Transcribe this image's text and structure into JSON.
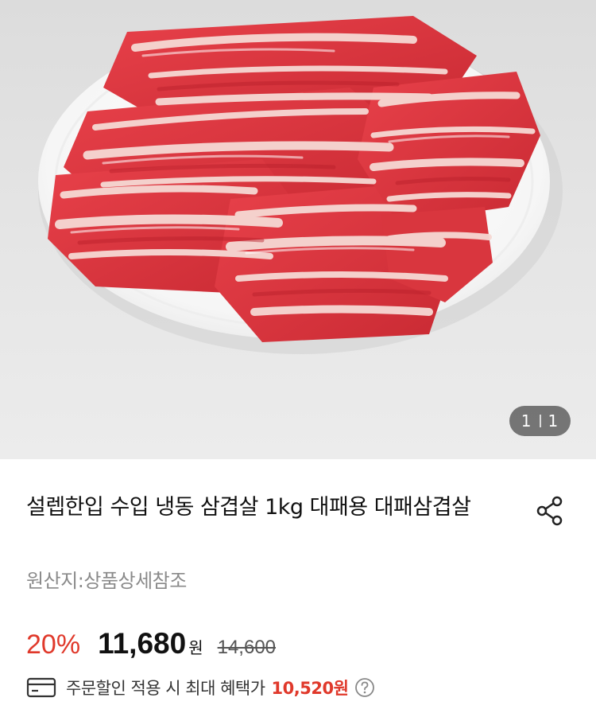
{
  "gallery": {
    "current": "1",
    "total": "1"
  },
  "product": {
    "title": "설렙한입 수입 냉동 삼겹살 1kg 대패용 대패삼겹살",
    "origin": "원산지:상품상세참조"
  },
  "pricing": {
    "discount": "20%",
    "price": "11,680",
    "price_unit": "원",
    "original_price": "14,600"
  },
  "benefit": {
    "text": "주문할인 적용 시 최대 혜택가",
    "amount": "10,520원"
  },
  "icons": {
    "share": "share-icon",
    "card": "card-icon",
    "help": "question-icon"
  },
  "colors": {
    "accent_red": "#e0392b",
    "text": "#111111",
    "muted": "#8a8a8a"
  }
}
